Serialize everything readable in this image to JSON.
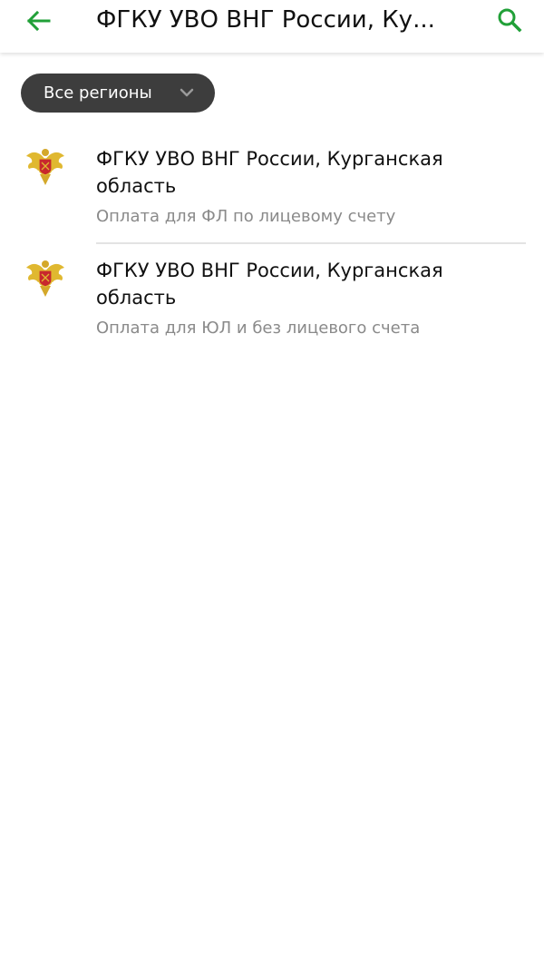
{
  "header": {
    "title": "ФГКУ УВО ВНГ России, Ку...",
    "back_icon": "arrow-left-icon",
    "search_icon": "search-icon"
  },
  "filter": {
    "label": "Все регионы",
    "icon": "chevron-down-icon"
  },
  "items": [
    {
      "title": "ФГКУ УВО ВНГ России, Курганская область",
      "subtitle": "Оплата для ФЛ по лицевому счету",
      "icon": "rosgvardia-emblem-icon"
    },
    {
      "title": "ФГКУ УВО ВНГ России, Курганская область",
      "subtitle": "Оплата для ЮЛ и без лицевого счета",
      "icon": "rosgvardia-emblem-icon"
    }
  ],
  "colors": {
    "accent": "#21a038",
    "chip_bg": "#3d3d3d",
    "subtitle": "#8a8a8a",
    "emblem_gold": "#e0b830",
    "emblem_red": "#c8282d"
  }
}
